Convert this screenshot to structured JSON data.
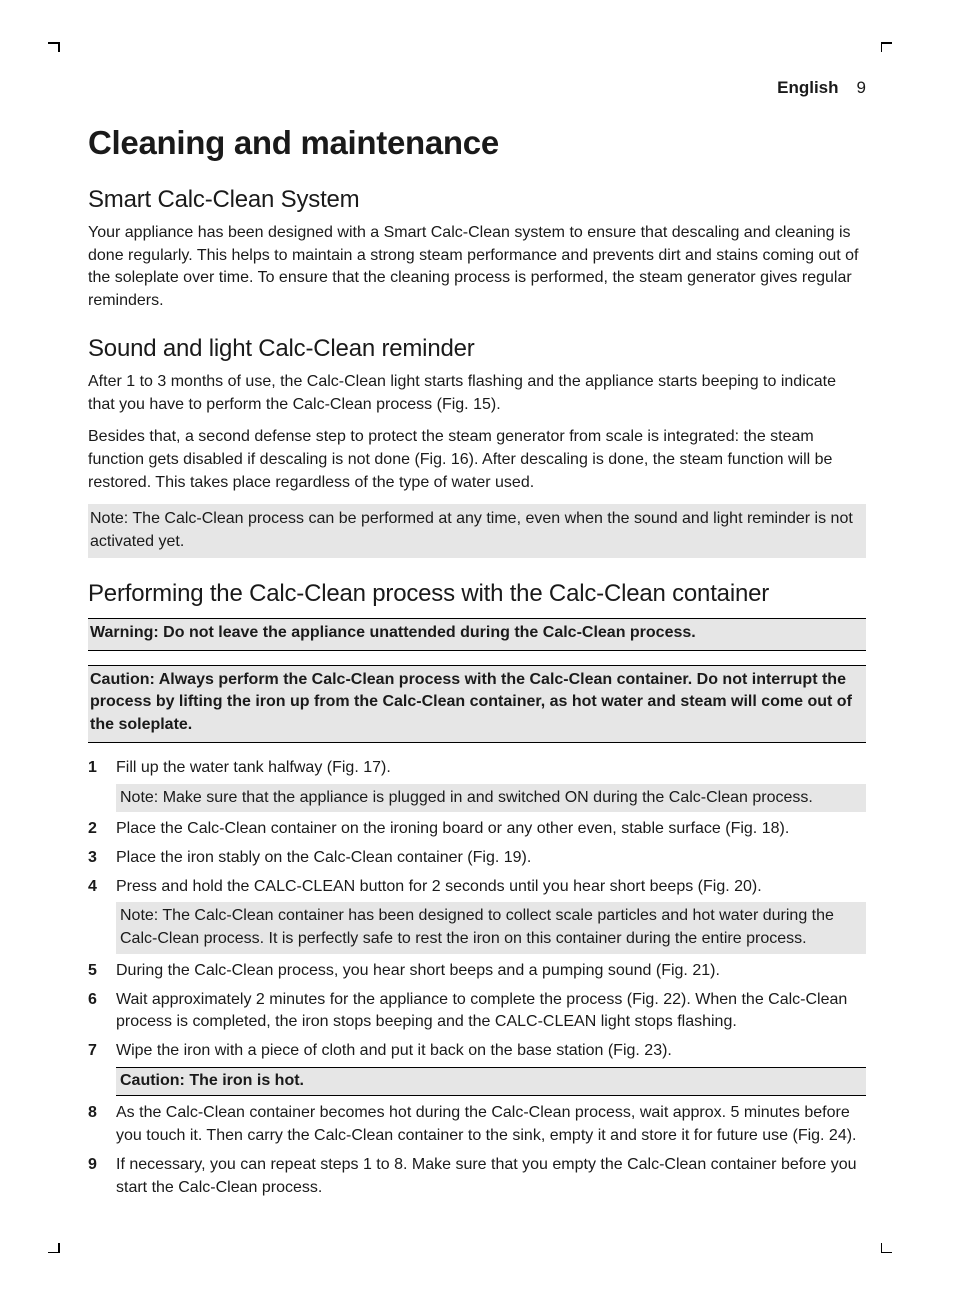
{
  "header": {
    "language": "English",
    "page_number": "9"
  },
  "title": "Cleaning and maintenance",
  "sections": {
    "smart": {
      "heading": "Smart Calc-Clean System",
      "p1": "Your appliance has been designed with a Smart Calc-Clean system to ensure that descaling and cleaning is done regularly. This helps to maintain a strong steam performance and prevents dirt and stains coming out of the soleplate over time. To ensure that the cleaning process is performed, the steam generator gives regular reminders."
    },
    "reminder": {
      "heading": "Sound and light Calc-Clean reminder",
      "p1": "After 1 to 3 months of use, the Calc-Clean light starts flashing and the appliance starts beeping to indicate that you have to perform the Calc-Clean process (Fig. 15).",
      "p2": "Besides that, a second defense step to protect the steam generator from scale is integrated: the steam function gets disabled if descaling is not done (Fig. 16). After descaling is done, the steam function will be restored. This takes place regardless of the type of water used.",
      "note": "Note: The Calc-Clean process can be performed at any time, even when the sound and light reminder is not activated yet."
    },
    "process": {
      "heading": "Performing the Calc-Clean process with the Calc-Clean container",
      "warning": "Warning: Do not leave the appliance unattended during the Calc-Clean process.",
      "caution": "Caution: Always perform the Calc-Clean process with the Calc-Clean container. Do not interrupt the process by lifting the iron up from the Calc-Clean container, as hot water and steam will come out of the soleplate.",
      "steps": {
        "s1": "Fill up the water tank halfway (Fig. 17).",
        "s1_note": "Note: Make sure that the appliance is plugged in and switched ON during the Calc-Clean process.",
        "s2": "Place the Calc-Clean container on the ironing board or any other even, stable surface (Fig. 18).",
        "s3": "Place the iron stably on the Calc-Clean container (Fig. 19).",
        "s4": "Press and hold the CALC-CLEAN button for 2 seconds until you hear short beeps (Fig. 20).",
        "s4_note": "Note: The Calc-Clean container has been designed to collect scale particles and hot water during the Calc-Clean process. It is perfectly safe to rest the iron on this container during the entire process.",
        "s5": "During the Calc-Clean process, you hear short beeps and a pumping sound (Fig. 21).",
        "s6": "Wait approximately 2 minutes for the appliance to complete the process (Fig. 22). When the Calc-Clean process is completed, the iron stops beeping and the CALC-CLEAN light stops flashing.",
        "s7": "Wipe the iron with a piece of cloth and put it back on the base station (Fig. 23).",
        "s7_warn": "Caution: The iron is hot.",
        "s8": "As the Calc-Clean container becomes hot during the Calc-Clean process, wait approx. 5 minutes before you touch it. Then carry the Calc-Clean container to the sink, empty it and store it for future use (Fig. 24).",
        "s9": "If necessary, you can repeat steps 1 to 8. Make sure that you empty the Calc-Clean container before you start the Calc-Clean process."
      }
    }
  }
}
